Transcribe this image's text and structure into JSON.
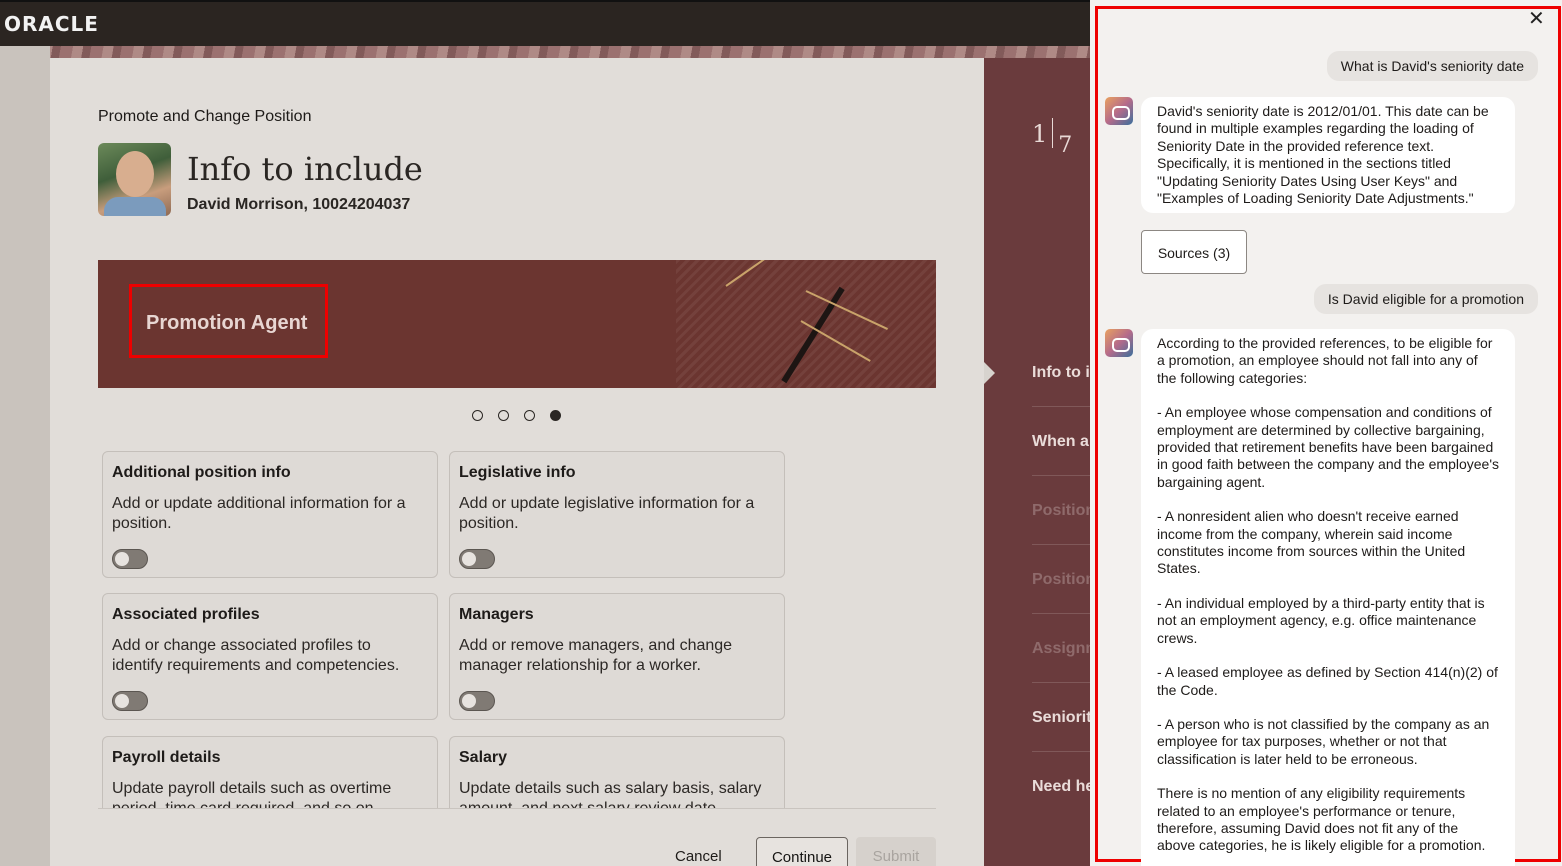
{
  "topbar": {
    "logo": "ORACLE"
  },
  "page": {
    "breadcrumb": "Promote and Change Position",
    "title": "Info to include",
    "person": "David Morrison, 10024204037",
    "banner_label": "Promotion Agent",
    "carousel": {
      "count": 4,
      "active": 4
    }
  },
  "cards": [
    {
      "title": "Additional position info",
      "desc": "Add or update additional information for a position.",
      "enabled": false
    },
    {
      "title": "Legislative info",
      "desc": "Add or update legislative information for a position.",
      "enabled": false
    },
    {
      "title": "Associated profiles",
      "desc": "Add or change associated profiles to identify requirements and competencies.",
      "enabled": false
    },
    {
      "title": "Managers",
      "desc": "Add or remove managers, and change manager relationship for a worker.",
      "enabled": false
    },
    {
      "title": "Payroll details",
      "desc": "Update payroll details such as overtime period, time card required, and so on.",
      "enabled": false
    },
    {
      "title": "Salary",
      "desc": "Update details such as salary basis, salary amount, and next salary review date.",
      "enabled": false
    }
  ],
  "footer": {
    "cancel": "Cancel",
    "continue": "Continue",
    "submit": "Submit"
  },
  "rail": {
    "current": "1",
    "total": "7",
    "items": [
      "Info to i",
      "When a",
      "Position",
      "Position",
      "Assignm",
      "Seniorit",
      "Need he"
    ]
  },
  "chat": {
    "close": "✕",
    "q1": "What is David's seniority date",
    "a1": "David's seniority date is 2012/01/01. This date can be found in multiple examples regarding the loading of Seniority Date in the provided reference text. Specifically, it is mentioned in the sections titled \"Updating Seniority Dates Using User Keys\" and \"Examples of Loading Seniority Date Adjustments.\"",
    "sources": "Sources (3)",
    "q2": "Is David eligible for a promotion",
    "a2": [
      "According to the provided references, to be eligible for a promotion, an employee should not fall into any of the following categories:",
      "- An employee whose compensation and conditions of employment are determined by collective bargaining, provided that retirement benefits have been bargained in good faith between the company and the employee's bargaining agent.",
      "- A nonresident alien who doesn't receive earned income from the company, wherein said income constitutes income from sources within the United States.",
      "- An individual employed by a third-party entity that is not an employment agency, e.g. office maintenance crews.",
      "- A leased employee as defined by Section 414(n)(2) of the Code.",
      "- A person who is not classified by the company as an employee for tax purposes, whether or not that classification is later held to be erroneous.",
      "There is no mention of any eligibility requirements related to an employee's performance or tenure, therefore, assuming David does not fit any of the above categories, he is likely eligible for a promotion."
    ]
  }
}
